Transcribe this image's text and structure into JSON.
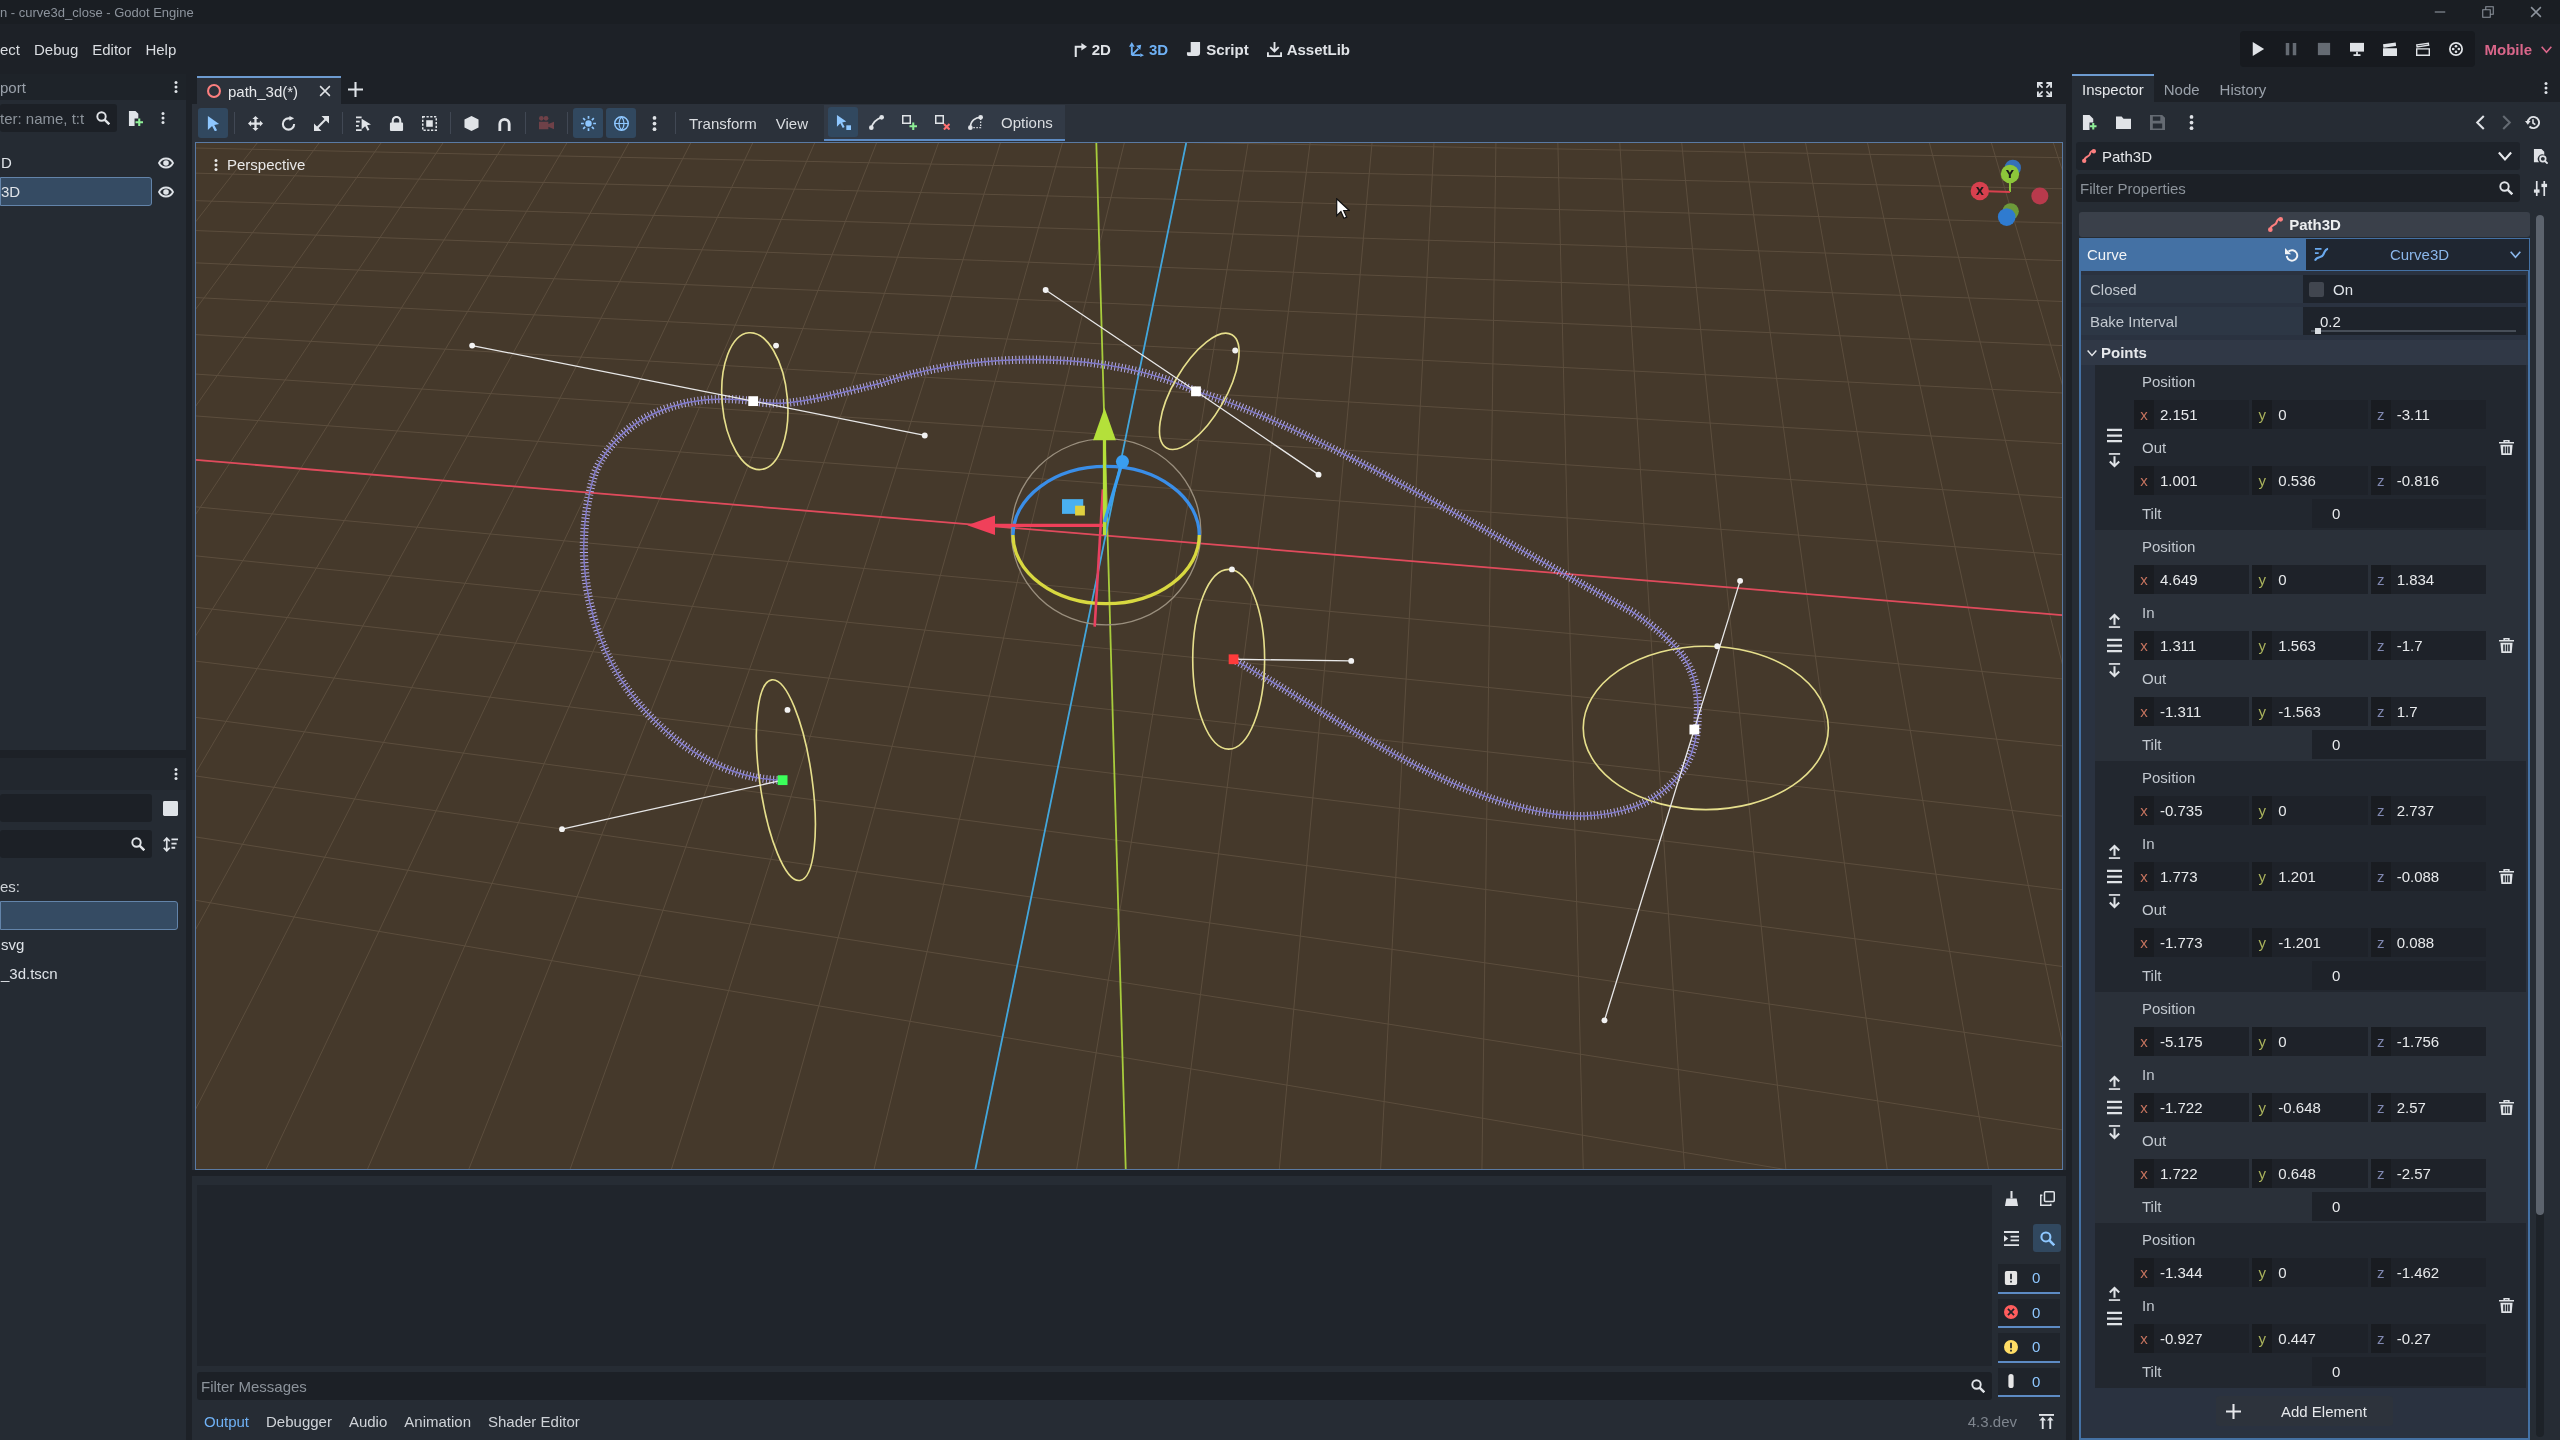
{
  "window": {
    "title": "n - curve3d_close - Godot Engine"
  },
  "menu": [
    "ect",
    "Debug",
    "Editor",
    "Help"
  ],
  "workspaces": [
    {
      "kind": "canvas",
      "label": "2D",
      "selected": false
    },
    {
      "kind": "spatial",
      "label": "3D",
      "selected": true
    },
    {
      "kind": "script",
      "label": "Script",
      "selected": false
    },
    {
      "kind": "assetlib",
      "label": "AssetLib",
      "selected": false
    }
  ],
  "run_buttons": [
    {
      "kind": "play",
      "disabled": false
    },
    {
      "kind": "pause",
      "disabled": true
    },
    {
      "kind": "stop",
      "disabled": true
    },
    {
      "kind": "remote",
      "disabled": false
    },
    {
      "kind": "play-scene",
      "disabled": false
    },
    {
      "kind": "play-custom",
      "disabled": false
    },
    {
      "kind": "movie",
      "disabled": false
    }
  ],
  "renderer": "Mobile",
  "scene_dock": {
    "tab": "port",
    "filter": {
      "placeholder": "ter: name, t:t"
    },
    "tree": [
      {
        "label": "D",
        "selected": false,
        "visible": true
      },
      {
        "label": "3D",
        "selected": true,
        "visible": true
      }
    ]
  },
  "filesystem_dock": {
    "favorites": "es:",
    "files": [
      {
        "selected": true
      },
      {
        "label": "svg",
        "selected": false
      },
      {
        "label": "_3d.tscn",
        "selected": false
      }
    ]
  },
  "scene_tabs": [
    {
      "label": "path_3d(*)",
      "selected": true
    }
  ],
  "toolbar": {
    "modes": [
      {
        "kind": "select",
        "selected": true
      },
      {
        "kind": "move",
        "selected": false
      },
      {
        "kind": "rotate",
        "selected": false
      },
      {
        "kind": "scale",
        "selected": false
      }
    ],
    "toggle_groups": [
      [
        {
          "kind": "local",
          "on": false,
          "disabled": false
        },
        {
          "kind": "snap",
          "on": false,
          "disabled": false
        }
      ],
      [
        {
          "kind": "camera",
          "on": false,
          "disabled": true
        }
      ],
      [
        {
          "kind": "sun",
          "on": true,
          "disabled": false
        },
        {
          "kind": "environment",
          "on": true,
          "disabled": false
        }
      ]
    ],
    "menus": [
      "Transform",
      "View"
    ],
    "path_modes": [
      {
        "kind": "select-points",
        "selected": true
      },
      {
        "kind": "edit-handles",
        "selected": false
      },
      {
        "kind": "add-point",
        "selected": false
      },
      {
        "kind": "delete-point",
        "selected": false
      }
    ],
    "options": "Options"
  },
  "viewport": {
    "view_menu": "Perspective",
    "gizmo": [
      "X",
      "Y"
    ]
  },
  "bottom_panel": {
    "search_on": true,
    "counters": [
      {
        "kind": "message",
        "count": "0",
        "on": true
      },
      {
        "kind": "error",
        "count": "0",
        "on": true
      },
      {
        "kind": "warning",
        "count": "0",
        "on": true
      },
      {
        "kind": "editor",
        "count": "0",
        "on": true
      }
    ],
    "filter": {
      "placeholder": "Filter Messages"
    },
    "tabs": [
      {
        "label": "Output",
        "selected": true
      },
      {
        "label": "Debugger",
        "selected": false
      },
      {
        "label": "Audio",
        "selected": false
      },
      {
        "label": "Animation",
        "selected": false
      },
      {
        "label": "Shader Editor",
        "selected": false
      }
    ],
    "version": "4.3.dev"
  },
  "inspector": {
    "tabs": [
      {
        "label": "Inspector",
        "selected": true
      },
      {
        "label": "Node",
        "selected": false
      },
      {
        "label": "History",
        "selected": false
      }
    ],
    "file_buttons": [
      {
        "kind": "new",
        "disabled": false
      },
      {
        "kind": "open",
        "disabled": false
      },
      {
        "kind": "save",
        "disabled": true
      }
    ],
    "nav_buttons": [
      {
        "kind": "back",
        "disabled": false
      },
      {
        "kind": "forward",
        "disabled": true
      }
    ],
    "object": "Path3D",
    "filter": {
      "placeholder": "Filter Properties"
    },
    "section": "Path3D",
    "curve": {
      "label": "Curve",
      "value": "Curve3D",
      "expanded": true
    },
    "closed": {
      "label": "Closed",
      "text": "On",
      "checked": false
    },
    "bake_interval": {
      "label": "Bake Interval",
      "value": "0.2",
      "level": 0.02
    },
    "points_group": {
      "label": "Points",
      "expanded": true
    },
    "points": [
      {
        "fields": [
          {
            "kind": "vector",
            "label": "Position",
            "components": [
              {
                "axis": "x",
                "value": "2.151",
                "color": "#c4735e"
              },
              {
                "axis": "y",
                "value": "0",
                "color": "#a9b25c"
              },
              {
                "axis": "z",
                "value": "-3.11",
                "color": "#8088b0"
              }
            ]
          },
          {
            "kind": "vector",
            "label": "Out",
            "components": [
              {
                "axis": "x",
                "value": "1.001",
                "color": "#c4735e"
              },
              {
                "axis": "y",
                "value": "0.536",
                "color": "#a9b25c"
              },
              {
                "axis": "z",
                "value": "-0.816",
                "color": "#8088b0"
              }
            ]
          },
          {
            "kind": "number",
            "label": "Tilt",
            "value": "0"
          }
        ]
      },
      {
        "fields": [
          {
            "kind": "vector",
            "label": "Position",
            "components": [
              {
                "axis": "x",
                "value": "4.649",
                "color": "#c4735e"
              },
              {
                "axis": "y",
                "value": "0",
                "color": "#a9b25c"
              },
              {
                "axis": "z",
                "value": "1.834",
                "color": "#8088b0"
              }
            ]
          },
          {
            "kind": "vector",
            "label": "In",
            "components": [
              {
                "axis": "x",
                "value": "1.311",
                "color": "#c4735e"
              },
              {
                "axis": "y",
                "value": "1.563",
                "color": "#a9b25c"
              },
              {
                "axis": "z",
                "value": "-1.7",
                "color": "#8088b0"
              }
            ]
          },
          {
            "kind": "vector",
            "label": "Out",
            "components": [
              {
                "axis": "x",
                "value": "-1.311",
                "color": "#c4735e"
              },
              {
                "axis": "y",
                "value": "-1.563",
                "color": "#a9b25c"
              },
              {
                "axis": "z",
                "value": "1.7",
                "color": "#8088b0"
              }
            ]
          },
          {
            "kind": "number",
            "label": "Tilt",
            "value": "0"
          }
        ]
      },
      {
        "fields": [
          {
            "kind": "vector",
            "label": "Position",
            "components": [
              {
                "axis": "x",
                "value": "-0.735",
                "color": "#c4735e"
              },
              {
                "axis": "y",
                "value": "0",
                "color": "#a9b25c"
              },
              {
                "axis": "z",
                "value": "2.737",
                "color": "#8088b0"
              }
            ]
          },
          {
            "kind": "vector",
            "label": "In",
            "components": [
              {
                "axis": "x",
                "value": "1.773",
                "color": "#c4735e"
              },
              {
                "axis": "y",
                "value": "1.201",
                "color": "#a9b25c"
              },
              {
                "axis": "z",
                "value": "-0.088",
                "color": "#8088b0"
              }
            ]
          },
          {
            "kind": "vector",
            "label": "Out",
            "components": [
              {
                "axis": "x",
                "value": "-1.773",
                "color": "#c4735e"
              },
              {
                "axis": "y",
                "value": "-1.201",
                "color": "#a9b25c"
              },
              {
                "axis": "z",
                "value": "0.088",
                "color": "#8088b0"
              }
            ]
          },
          {
            "kind": "number",
            "label": "Tilt",
            "value": "0"
          }
        ]
      },
      {
        "fields": [
          {
            "kind": "vector",
            "label": "Position",
            "components": [
              {
                "axis": "x",
                "value": "-5.175",
                "color": "#c4735e"
              },
              {
                "axis": "y",
                "value": "0",
                "color": "#a9b25c"
              },
              {
                "axis": "z",
                "value": "-1.756",
                "color": "#8088b0"
              }
            ]
          },
          {
            "kind": "vector",
            "label": "In",
            "components": [
              {
                "axis": "x",
                "value": "-1.722",
                "color": "#c4735e"
              },
              {
                "axis": "y",
                "value": "-0.648",
                "color": "#a9b25c"
              },
              {
                "axis": "z",
                "value": "2.57",
                "color": "#8088b0"
              }
            ]
          },
          {
            "kind": "vector",
            "label": "Out",
            "components": [
              {
                "axis": "x",
                "value": "1.722",
                "color": "#c4735e"
              },
              {
                "axis": "y",
                "value": "0.648",
                "color": "#a9b25c"
              },
              {
                "axis": "z",
                "value": "-2.57",
                "color": "#8088b0"
              }
            ]
          },
          {
            "kind": "number",
            "label": "Tilt",
            "value": "0"
          }
        ]
      },
      {
        "fields": [
          {
            "kind": "vector",
            "label": "Position",
            "components": [
              {
                "axis": "x",
                "value": "-1.344",
                "color": "#c4735e"
              },
              {
                "axis": "y",
                "value": "0",
                "color": "#a9b25c"
              },
              {
                "axis": "z",
                "value": "-1.462",
                "color": "#8088b0"
              }
            ]
          },
          {
            "kind": "vector",
            "label": "In",
            "components": [
              {
                "axis": "x",
                "value": "-0.927",
                "color": "#c4735e"
              },
              {
                "axis": "y",
                "value": "0.447",
                "color": "#a9b25c"
              },
              {
                "axis": "z",
                "value": "-0.27",
                "color": "#8088b0"
              }
            ]
          },
          {
            "kind": "number",
            "label": "Tilt",
            "value": "0"
          }
        ]
      }
    ],
    "add_button": "Add Element"
  }
}
